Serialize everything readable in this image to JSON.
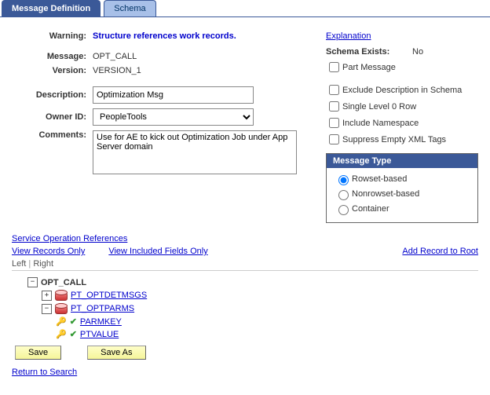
{
  "tabs": {
    "definition": "Message Definition",
    "schema": "Schema"
  },
  "warning": {
    "label": "Warning:",
    "text": "Structure references work records."
  },
  "message": {
    "label": "Message:",
    "value": "OPT_CALL"
  },
  "version": {
    "label": "Version:",
    "value": "VERSION_1"
  },
  "description": {
    "label": "Description:",
    "value": "Optimization Msg"
  },
  "owner": {
    "label": "Owner ID:",
    "value": "PeopleTools"
  },
  "comments": {
    "label": "Comments:",
    "value": "Use for AE to kick out Optimization Job under App Server domain"
  },
  "right": {
    "explanation": "Explanation",
    "schemaExistsLabel": "Schema Exists:",
    "schemaExistsValue": "No",
    "partMessage": "Part Message",
    "excludeDesc": "Exclude Description in Schema",
    "singleLevel": "Single Level 0 Row",
    "includeNs": "Include Namespace",
    "suppressEmpty": "Suppress Empty XML Tags",
    "msgTypeHeader": "Message Type",
    "rowset": "Rowset-based",
    "nonrowset": "Nonrowset-based",
    "container": "Container"
  },
  "links": {
    "serviceOp": "Service Operation References",
    "viewRecords": "View Records Only",
    "viewIncluded": "View Included Fields Only",
    "addRecord": "Add Record to Root",
    "left": "Left",
    "right": "Right",
    "return": "Return to Search"
  },
  "tree": {
    "root": "OPT_CALL",
    "child1": "PT_OPTDETMSGS",
    "child2": "PT_OPTPARMS",
    "field1": "PARMKEY",
    "field2": "PTVALUE"
  },
  "buttons": {
    "save": "Save",
    "saveAs": "Save As"
  }
}
